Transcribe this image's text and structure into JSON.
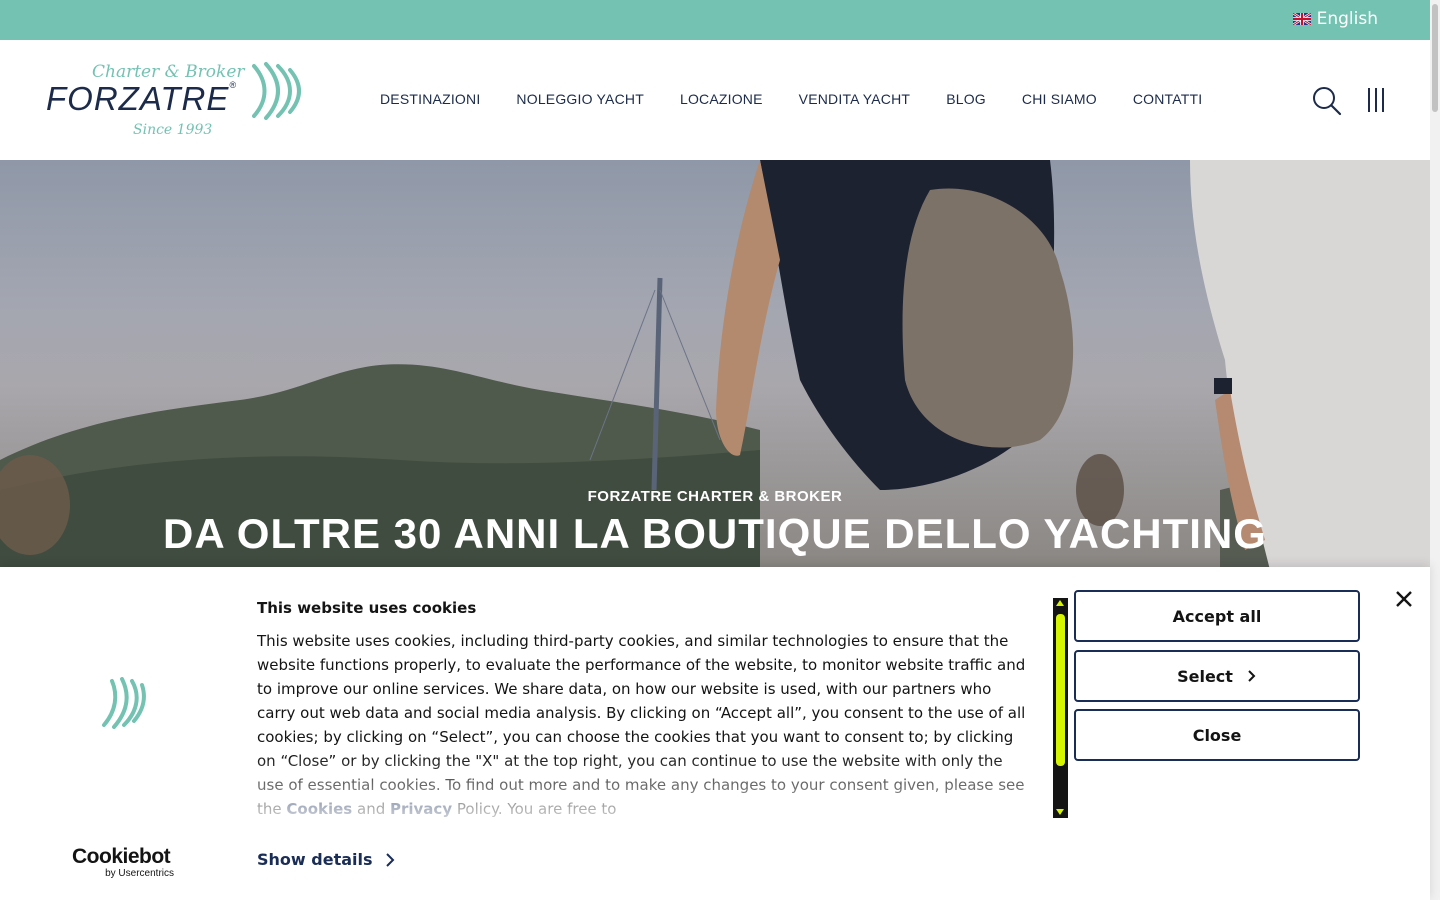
{
  "topbar": {
    "language_label": "English",
    "flag_icon": "uk-flag-icon",
    "background_color": "#74c2b2"
  },
  "header": {
    "logo": {
      "tagline": "Charter & Broker",
      "brand": "FORZATRE",
      "registered": "®",
      "since": "Since 1993"
    },
    "nav": [
      {
        "label": "DESTINAZIONI"
      },
      {
        "label": "NOLEGGIO YACHT"
      },
      {
        "label": "LOCAZIONE"
      },
      {
        "label": "VENDITA YACHT"
      },
      {
        "label": "BLOG"
      },
      {
        "label": "CHI SIAMO"
      },
      {
        "label": "CONTATTI"
      }
    ],
    "icons": {
      "search": "search-icon",
      "menu": "menu-icon"
    },
    "text_color": "#1c2b4a"
  },
  "hero": {
    "subtitle": "FORZATRE CHARTER & BROKER",
    "title": "DA OLTRE 30 ANNI LA BOUTIQUE DELLO YACHTING"
  },
  "cookie_banner": {
    "title": "This website uses cookies",
    "body_part1": "This website uses cookies, including third-party cookies, and similar technologies to ensure that the website functions properly, to evaluate the performance of the website, to monitor website traffic and to improve our online services. We share data, on how our website is used, with our partners who carry out web data and social media analysis. By clicking on “Accept all”, you consent to the use of all cookies; by clicking on “Select”, you can choose the cookies that you want to consent to; by clicking on “Close” or by clicking the \"X\" at the top right, you can continue to use the website with only the use of essential cookies. To find out more and to make any changes to your consent given, please see the ",
    "link_cookies": "Cookies",
    "and_text": " and ",
    "link_privacy": "Privacy",
    "body_part2": " Policy. You are free to",
    "show_details": "Show details",
    "buttons": {
      "accept_all": "Accept all",
      "select": "Select",
      "close": "Close"
    },
    "powered_by": {
      "name": "Cookiebot",
      "by": "by Usercentrics"
    },
    "accent_color": "#1a2d56",
    "scroll_color": "#d6f500"
  }
}
